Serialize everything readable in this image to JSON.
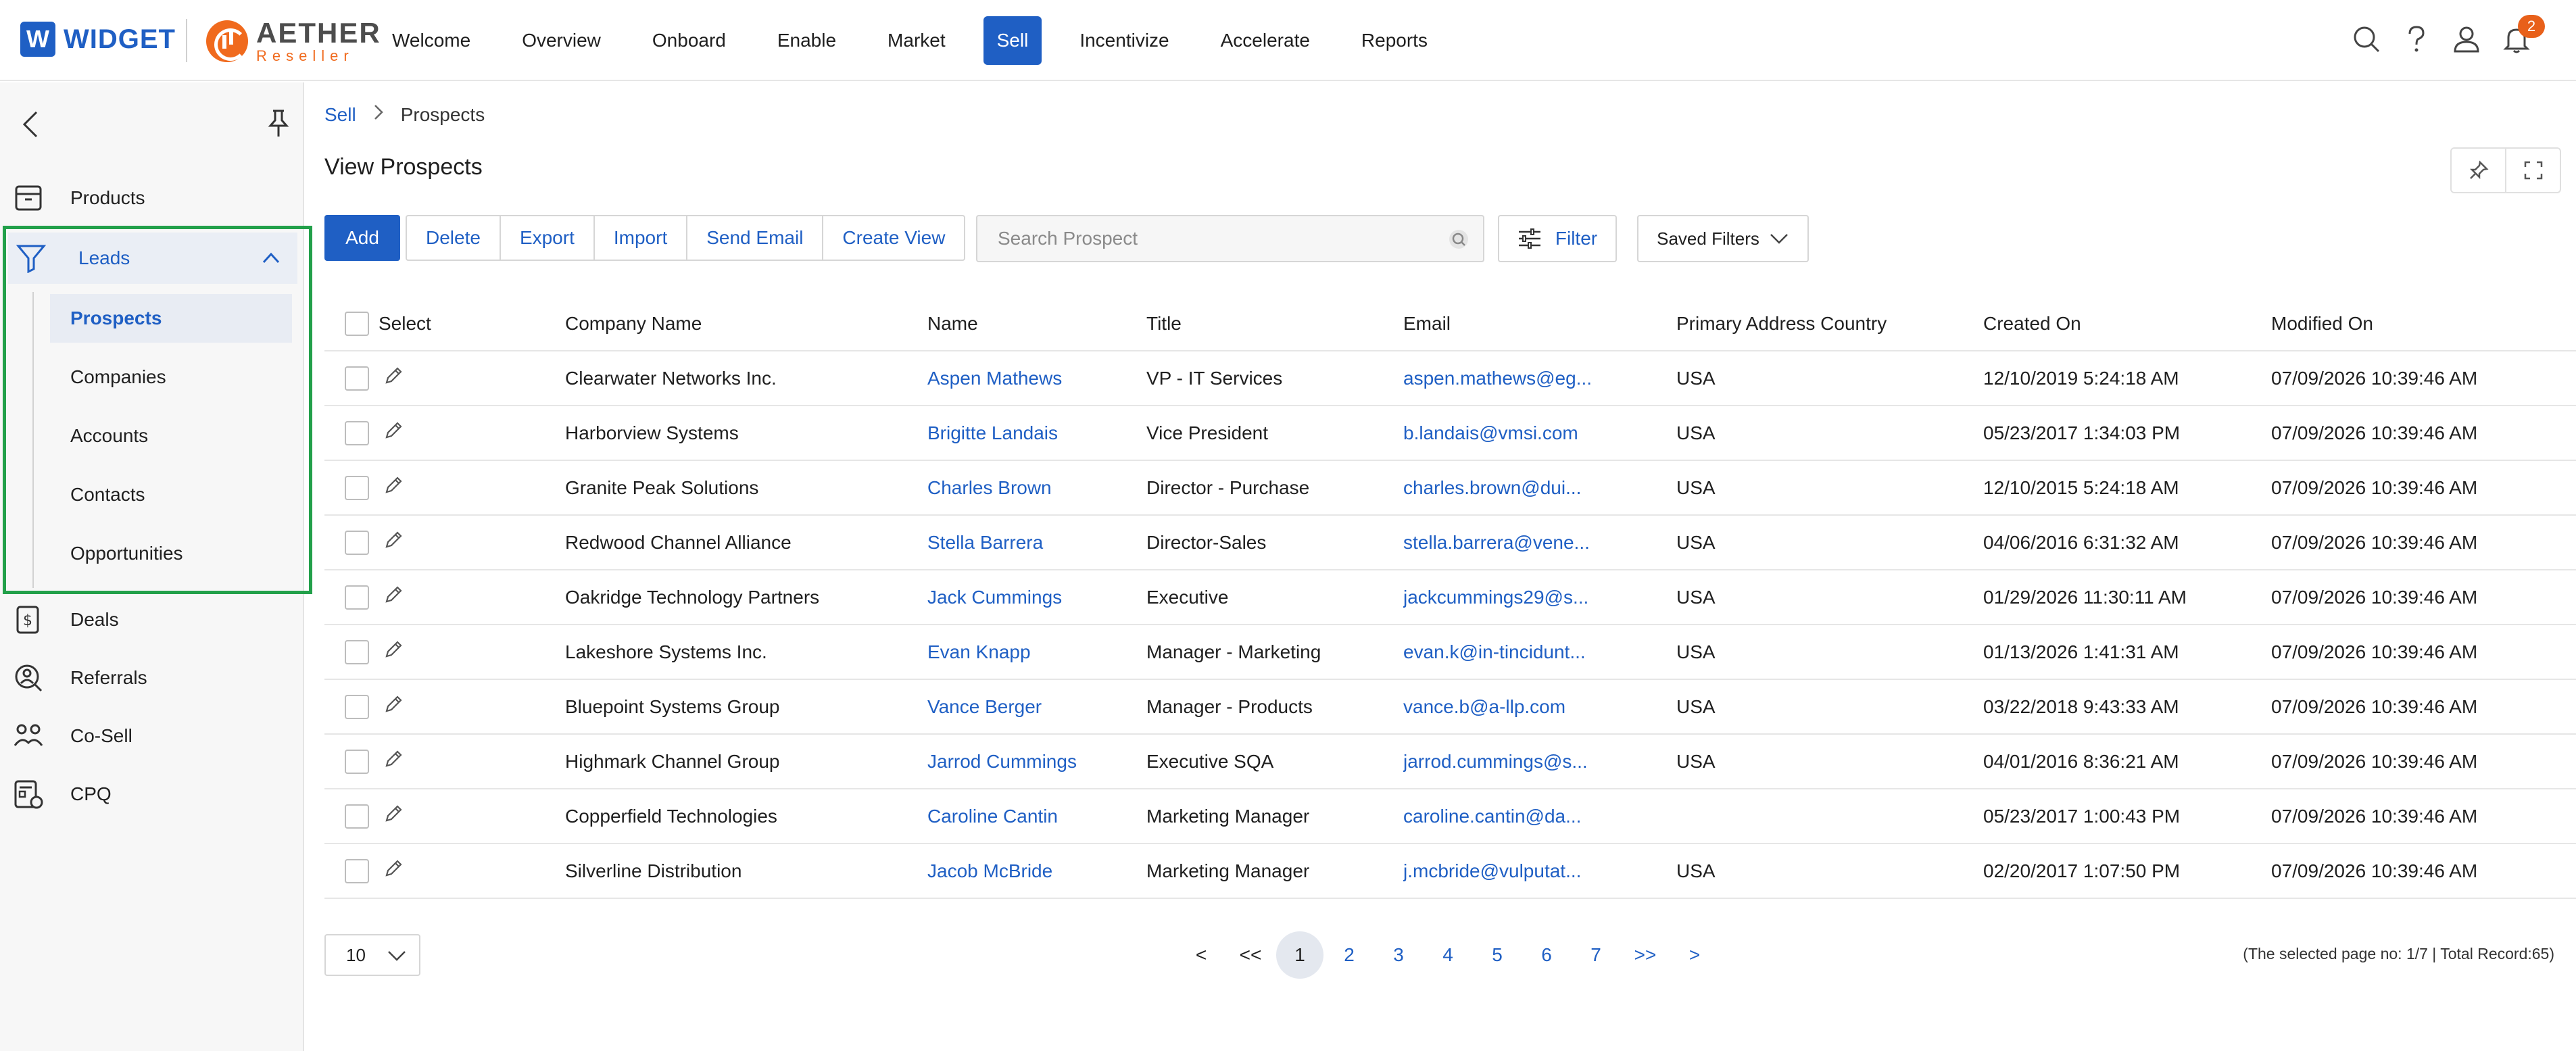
{
  "header": {
    "logo_widget": "WIDGET",
    "logo_w": "W",
    "logo_aether": "AETHER",
    "logo_aether_sub": "Reseller",
    "nav": [
      {
        "label": "Welcome",
        "active": false
      },
      {
        "label": "Overview",
        "active": false
      },
      {
        "label": "Onboard",
        "active": false
      },
      {
        "label": "Enable",
        "active": false
      },
      {
        "label": "Market",
        "active": false
      },
      {
        "label": "Sell",
        "active": true
      },
      {
        "label": "Incentivize",
        "active": false
      },
      {
        "label": "Accelerate",
        "active": false
      },
      {
        "label": "Reports",
        "active": false
      }
    ],
    "notification_count": "2",
    "icons": [
      "search-icon",
      "help-icon",
      "user-icon",
      "bell-icon"
    ]
  },
  "sidebar": {
    "items": [
      {
        "label": "Products",
        "icon": "box-icon"
      },
      {
        "label": "Leads",
        "icon": "funnel-icon"
      },
      {
        "label": "Deals",
        "icon": "dollar-doc-icon"
      },
      {
        "label": "Referrals",
        "icon": "person-search-icon"
      },
      {
        "label": "Co-Sell",
        "icon": "handshake-icon"
      },
      {
        "label": "CPQ",
        "icon": "calculator-doc-icon"
      }
    ],
    "leads_sub": [
      {
        "label": "Prospects",
        "active": true
      },
      {
        "label": "Companies",
        "active": false
      },
      {
        "label": "Accounts",
        "active": false
      },
      {
        "label": "Contacts",
        "active": false
      },
      {
        "label": "Opportunities",
        "active": false
      }
    ]
  },
  "main": {
    "breadcrumb": {
      "parent": "Sell",
      "current": "Prospects"
    },
    "title": "View Prospects",
    "actions": {
      "add": "Add",
      "group": [
        "Delete",
        "Export",
        "Import",
        "Send Email",
        "Create View"
      ]
    },
    "search": {
      "placeholder": "Search Prospect",
      "value": ""
    },
    "filter_label": "Filter",
    "saved_filters_label": "Saved Filters",
    "table": {
      "headers": {
        "select": "Select",
        "company": "Company Name",
        "name": "Name",
        "title": "Title",
        "email": "Email",
        "country": "Primary Address Country",
        "created": "Created On",
        "modified": "Modified On"
      },
      "rows": [
        {
          "company": "Clearwater Networks Inc.",
          "name": "Aspen Mathews",
          "title": "VP - IT Services",
          "email": "aspen.mathews@eg...",
          "country": "USA",
          "created": "12/10/2019 5:24:18 AM",
          "modified": "07/09/2026 10:39:46 AM"
        },
        {
          "company": "Harborview Systems",
          "name": "Brigitte Landais",
          "title": "Vice President",
          "email": "b.landais@vmsi.com",
          "country": "USA",
          "created": "05/23/2017 1:34:03 PM",
          "modified": "07/09/2026 10:39:46 AM"
        },
        {
          "company": "Granite Peak Solutions",
          "name": "Charles Brown",
          "title": "Director - Purchase",
          "email": "charles.brown@dui...",
          "country": "USA",
          "created": "12/10/2015 5:24:18 AM",
          "modified": "07/09/2026 10:39:46 AM"
        },
        {
          "company": "Redwood Channel Alliance",
          "name": "Stella Barrera",
          "title": "Director-Sales",
          "email": "stella.barrera@vene...",
          "country": "USA",
          "created": "04/06/2016 6:31:32 AM",
          "modified": "07/09/2026 10:39:46 AM"
        },
        {
          "company": "Oakridge Technology Partners",
          "name": "Jack Cummings",
          "title": "Executive",
          "email": "jackcummings29@s...",
          "country": "USA",
          "created": "01/29/2026 11:30:11 AM",
          "modified": "07/09/2026 10:39:46 AM"
        },
        {
          "company": "Lakeshore Systems Inc.",
          "name": "Evan Knapp",
          "title": "Manager - Marketing",
          "email": "evan.k@in-tincidunt...",
          "country": "USA",
          "created": "01/13/2026 1:41:31 AM",
          "modified": "07/09/2026 10:39:46 AM"
        },
        {
          "company": "Bluepoint Systems Group",
          "name": "Vance Berger",
          "title": "Manager - Products",
          "email": "vance.b@a-llp.com",
          "country": "USA",
          "created": "03/22/2018 9:43:33 AM",
          "modified": "07/09/2026 10:39:46 AM"
        },
        {
          "company": "Highmark Channel Group",
          "name": "Jarrod Cummings",
          "title": "Executive SQA",
          "email": "jarrod.cummings@s...",
          "country": "USA",
          "created": "04/01/2016 8:36:21 AM",
          "modified": "07/09/2026 10:39:46 AM"
        },
        {
          "company": "Copperfield Technologies",
          "name": "Caroline Cantin",
          "title": "Marketing Manager",
          "email": "caroline.cantin@da...",
          "country": "",
          "created": "05/23/2017 1:00:43 PM",
          "modified": "07/09/2026 10:39:46 AM"
        },
        {
          "company": "Silverline Distribution",
          "name": "Jacob McBride",
          "title": "Marketing Manager",
          "email": "j.mcbride@vulputat...",
          "country": "USA",
          "created": "02/20/2017 1:07:50 PM",
          "modified": "07/09/2026 10:39:46 AM"
        }
      ]
    },
    "pagination": {
      "page_size": "10",
      "prev": "<",
      "first": "<<",
      "pages": [
        "1",
        "2",
        "3",
        "4",
        "5",
        "6",
        "7"
      ],
      "current": "1",
      "last": ">>",
      "next": ">",
      "info": "(The selected page no: 1/7 | Total Record:65)"
    }
  },
  "colors": {
    "accent": "#1f5fc4",
    "highlight_border": "#22a04a",
    "badge": "#e8601a",
    "aether": "#f06a1d"
  }
}
